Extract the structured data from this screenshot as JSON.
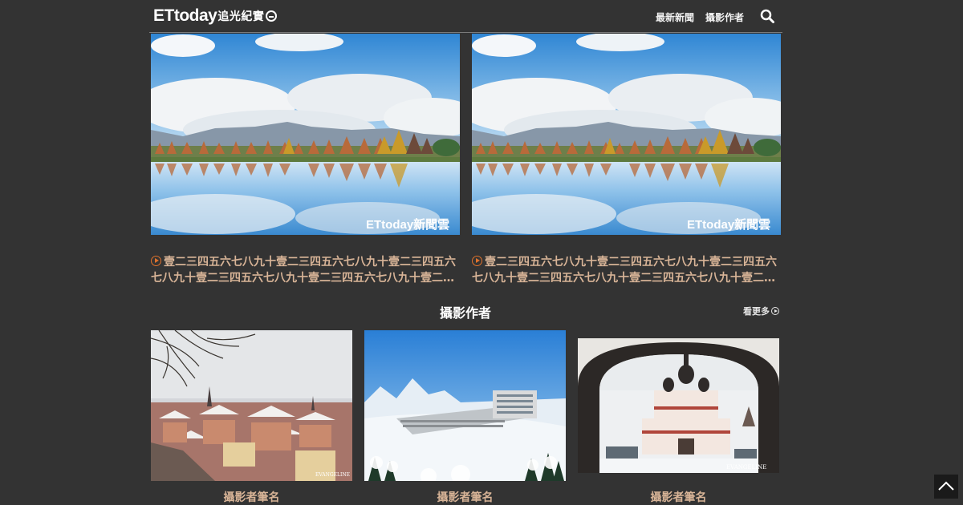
{
  "header": {
    "logo_main": "ETtoday",
    "logo_sub": "追光紀實",
    "nav": [
      "最新新聞",
      "攝影作者"
    ]
  },
  "features": [
    {
      "title": "壹二三四五六七八九十壹二三四五六七八九十壹二三四五六七八九十壹二三四五六七八九十壹二三四五六七八九十壹二…",
      "watermark": "ETtoday新聞雲"
    },
    {
      "title": "壹二三四五六七八九十壹二三四五六七八九十壹二三四五六七八九十壹二三四五六七八九十壹二三四五六七八九十壹二…",
      "watermark": "ETtoday新聞雲"
    }
  ],
  "section": {
    "title": "攝影作者",
    "more_label": "看更多"
  },
  "authors": [
    {
      "name": "攝影者筆名",
      "watermark": "EVANGELINE"
    },
    {
      "name": "攝影者筆名",
      "watermark": ""
    },
    {
      "name": "攝影者筆名",
      "watermark": "EVANGELINE"
    }
  ],
  "icons": {
    "search": "search-icon",
    "play": "play-circle-icon",
    "more": "arrow-circle-icon",
    "top": "chevron-up-icon"
  },
  "colors": {
    "background": "#333333",
    "title_text": "#d8b497",
    "accent": "#e0722c"
  }
}
